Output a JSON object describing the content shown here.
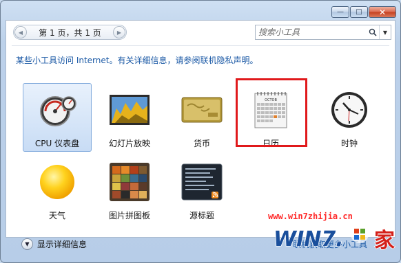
{
  "window": {
    "buttons": {
      "minimize": "—",
      "maximize": "□",
      "close": "✕"
    }
  },
  "toolbar": {
    "pager_text": "第 1 页，共 1 页",
    "prev_glyph": "◀",
    "next_glyph": "▶",
    "search_placeholder": "搜索小工具",
    "dropdown_glyph": "▼"
  },
  "notice": "某些小工具访问 Internet。有关详细信息，请参阅联机隐私声明。",
  "gadgets": [
    {
      "label": "CPU 仪表盘",
      "icon": "cpu-meter-icon",
      "selected": true
    },
    {
      "label": "幻灯片放映",
      "icon": "slideshow-icon",
      "selected": false
    },
    {
      "label": "货币",
      "icon": "currency-icon",
      "selected": false
    },
    {
      "label": "日历",
      "icon": "calendar-icon",
      "selected": false,
      "highlighted": true
    },
    {
      "label": "时钟",
      "icon": "clock-icon",
      "selected": false
    },
    {
      "label": "天气",
      "icon": "weather-icon",
      "selected": false
    },
    {
      "label": "图片拼图板",
      "icon": "picture-puzzle-icon",
      "selected": false
    },
    {
      "label": "源标题",
      "icon": "feed-headlines-icon",
      "selected": false
    }
  ],
  "calendar_month": "OCTOB",
  "footer": {
    "details_label": "显示详细信息",
    "online_link": "联机获取更多小工具"
  },
  "watermark": {
    "url": "www.win7zhijia.cn",
    "logo_text": "WIN7.",
    "home_char": "家"
  },
  "colors": {
    "accent_link": "#1c5aa6",
    "highlight_box": "#e0191b",
    "watermark": "#ff2a2a"
  }
}
